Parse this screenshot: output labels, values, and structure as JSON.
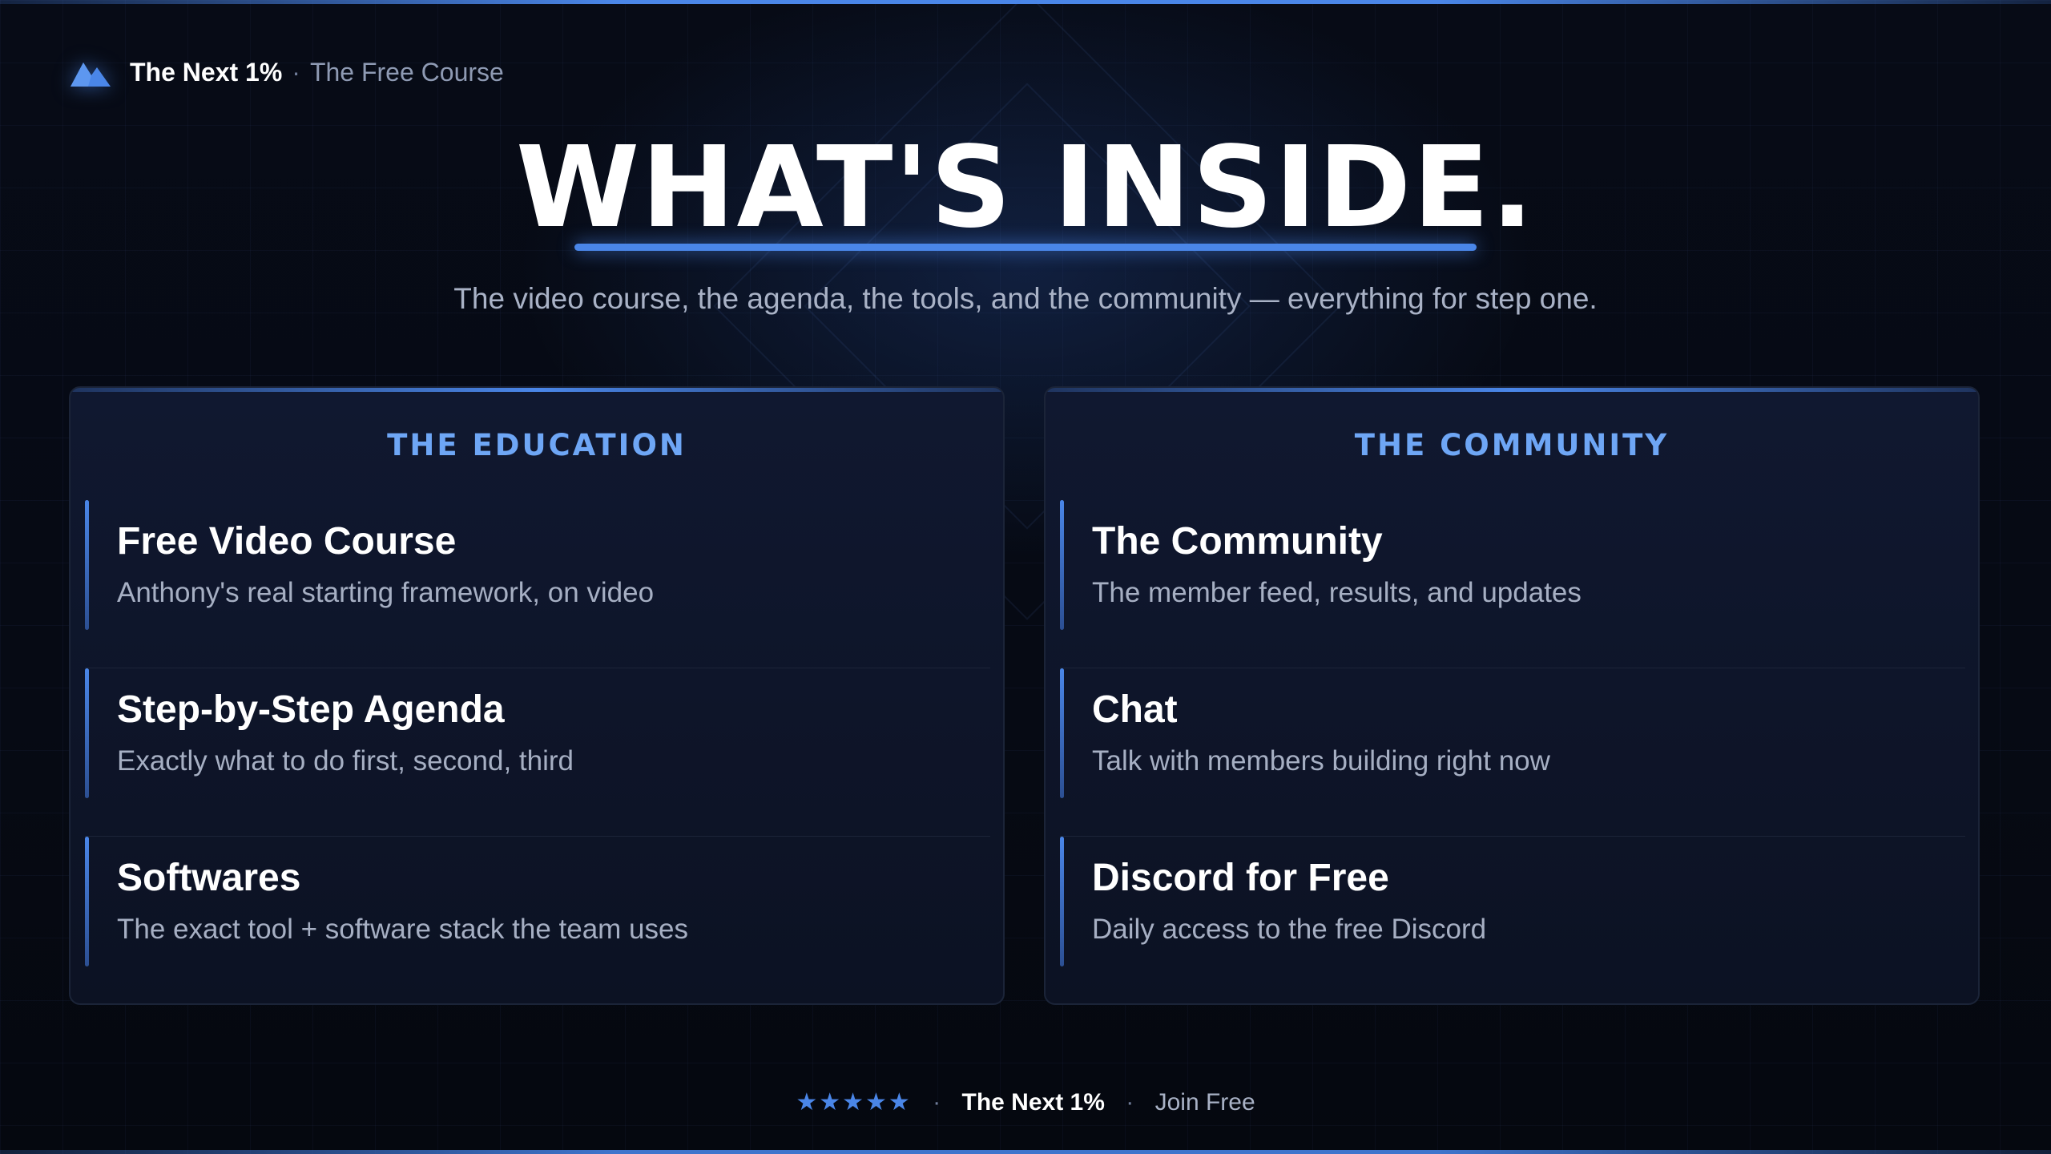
{
  "brand": {
    "logo_icon": "mountain-icon",
    "name": "The Next 1%",
    "separator": "·",
    "subtitle": "The Free Course"
  },
  "hero": {
    "title": "WHAT'S INSIDE.",
    "subtitle": "The video course, the agenda, the tools, and the community — everything for step one."
  },
  "panels": [
    {
      "heading": "THE EDUCATION",
      "items": [
        {
          "title": "Free Video Course",
          "description": "Anthony's real starting framework, on video"
        },
        {
          "title": "Step-by-Step Agenda",
          "description": "Exactly what to do first, second, third"
        },
        {
          "title": "Softwares",
          "description": "The exact tool + software stack the team uses"
        }
      ]
    },
    {
      "heading": "THE COMMUNITY",
      "items": [
        {
          "title": "The Community",
          "description": "The member feed, results, and updates"
        },
        {
          "title": "Chat",
          "description": "Talk with members building right now"
        },
        {
          "title": "Discord for Free",
          "description": "Daily access to the free Discord"
        }
      ]
    }
  ],
  "footer": {
    "stars": "★★★★★",
    "rating_stars_count": 5,
    "separator": "·",
    "brand": "The Next 1%",
    "cta": "Join Free"
  },
  "colors": {
    "accent": "#4a86e8",
    "heading_accent": "#6ea6f5",
    "background": "#070b16",
    "panel": "#101830"
  }
}
